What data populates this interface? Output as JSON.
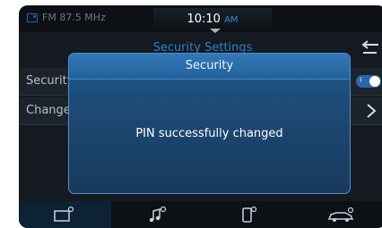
{
  "status": {
    "radio_text": "FM 87.5 MHz",
    "time": "10:10",
    "ampm": "AM"
  },
  "settings": {
    "title": "Security Settings",
    "rows": [
      {
        "label": "Security",
        "toggle_text": "I"
      },
      {
        "label": "Change PIN"
      }
    ]
  },
  "dialog": {
    "title": "Security",
    "message": "PIN successfully changed"
  },
  "nav": {
    "items": [
      {
        "icon": "radio-icon",
        "active": true
      },
      {
        "icon": "music-icon",
        "active": false
      },
      {
        "icon": "phone-icon",
        "active": false
      },
      {
        "icon": "car-icon",
        "active": false
      }
    ]
  },
  "colors": {
    "accent": "#2e8ee0",
    "dialog": "#1e4c79",
    "background": "#151a20"
  }
}
